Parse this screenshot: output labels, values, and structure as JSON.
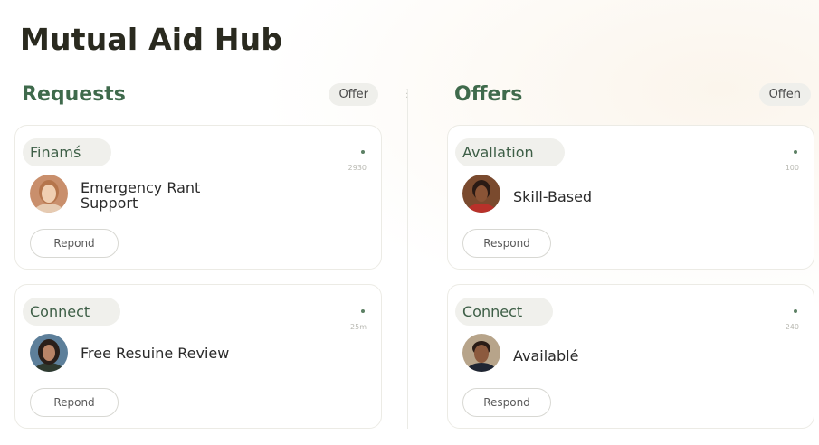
{
  "app": {
    "title": "Mutual Aid Hub"
  },
  "requests": {
    "title": "Requests",
    "pill": "Offer",
    "cards": [
      {
        "tag": "Finamś",
        "meta": "2930",
        "text_line1": "Emergency Rant",
        "text_line2": "Support",
        "button": "Repond",
        "avatar": "woman-avatar"
      },
      {
        "tag": "Connect",
        "meta": "25m",
        "text_line1": "Free Resuine Review",
        "text_line2": "",
        "button": "Repond",
        "avatar": "woman-avatar"
      }
    ]
  },
  "offers": {
    "title": "Offers",
    "pill": "Offen",
    "cards": [
      {
        "tag": "Avallation",
        "meta": "100",
        "text_line1": "Skill-Based",
        "text_line2": "",
        "button": "Respond",
        "avatar": "man-avatar"
      },
      {
        "tag": "Connect",
        "meta": "240",
        "text_line1": "Availablé",
        "text_line2": "",
        "button": "Respond",
        "avatar": "man-avatar"
      }
    ]
  },
  "colors": {
    "accent": "#3f6a4c",
    "title": "#2a2a1f",
    "pill_bg": "#efefeb"
  }
}
